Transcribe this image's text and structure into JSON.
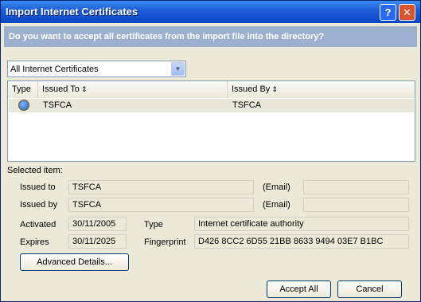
{
  "window": {
    "title": "Import Internet Certificates",
    "help_label": "?",
    "close_label": "✕"
  },
  "question": "Do you want to accept all certificates from the import file into the directory?",
  "filter": {
    "selected": "All Internet Certificates"
  },
  "list": {
    "columns": [
      "Type",
      "Issued To",
      "Issued By"
    ],
    "rows": [
      {
        "type_icon": "certificate-icon",
        "issued_to": "TSFCA",
        "issued_by": "TSFCA"
      }
    ]
  },
  "selected_item": {
    "label": "Selected item:",
    "issued_to_label": "Issued to",
    "issued_to_value": "TSFCA",
    "issued_by_label": "Issued by",
    "issued_by_value": "TSFCA",
    "email_label": "(Email)",
    "email_to_value": "",
    "email_by_value": "",
    "activated_label": "Activated",
    "activated_value": "30/11/2005",
    "expires_label": "Expires",
    "expires_value": "30/11/2025",
    "type_label": "Type",
    "type_value": "Internet certificate authority",
    "fingerprint_label": "Fingerprint",
    "fingerprint_value": "D426 8CC2 6D55 21BB 8633 9494 03E7 B1BC"
  },
  "buttons": {
    "advanced": "Advanced Details...",
    "accept": "Accept All",
    "cancel": "Cancel"
  },
  "icons": {
    "sort": "⇕",
    "dropdown": "▼"
  }
}
